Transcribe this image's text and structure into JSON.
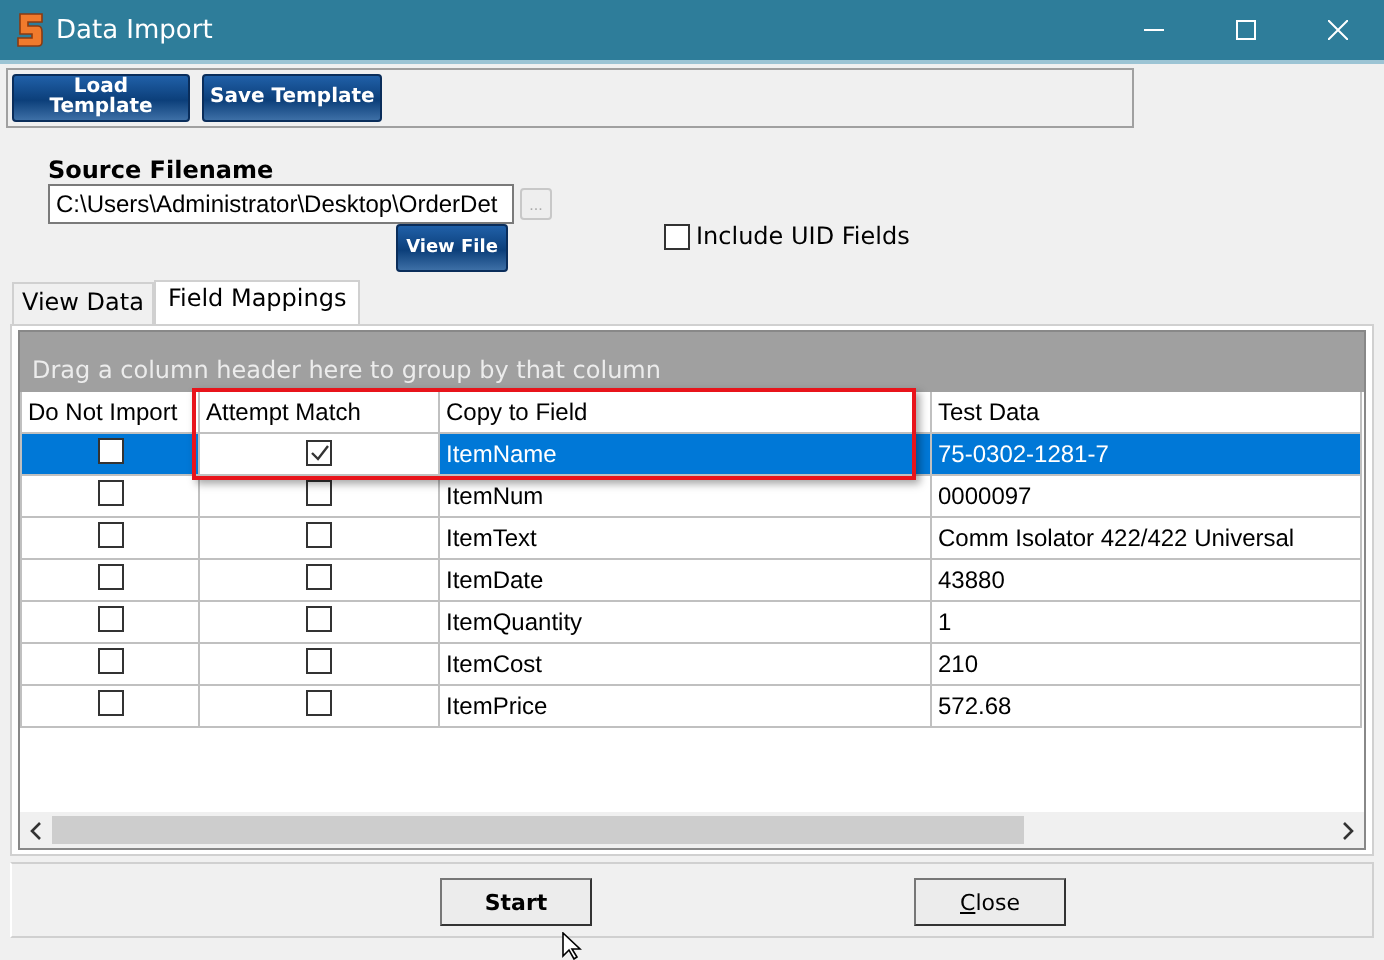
{
  "window": {
    "title": "Data Import"
  },
  "toolbar": {
    "buttons": [
      "Load Template",
      "Save Template"
    ]
  },
  "source": {
    "label": "Source Filename",
    "value": "C:\\Users\\Administrator\\Desktop\\OrderDet",
    "browse": "...",
    "view_button": "View File"
  },
  "include_uid": {
    "label": "Include UID Fields",
    "checked": false
  },
  "tabs": [
    {
      "label": "View Data",
      "selected": false
    },
    {
      "label": "Field Mappings",
      "selected": true
    }
  ],
  "grid": {
    "group_hint": "Drag a column header here to group by that column",
    "columns": [
      "Do Not Import",
      "Attempt Match",
      "Copy to Field",
      "Test Data"
    ],
    "rows": [
      {
        "do_not_import": false,
        "attempt_match": true,
        "field": "ItemName",
        "test_data": "75-0302-1281-7",
        "selected": true
      },
      {
        "do_not_import": false,
        "attempt_match": false,
        "field": "ItemNum",
        "test_data": "0000097",
        "selected": false
      },
      {
        "do_not_import": false,
        "attempt_match": false,
        "field": "ItemText",
        "test_data": "Comm Isolator 422/422 Universal",
        "selected": false
      },
      {
        "do_not_import": false,
        "attempt_match": false,
        "field": "ItemDate",
        "test_data": "43880",
        "selected": false
      },
      {
        "do_not_import": false,
        "attempt_match": false,
        "field": "ItemQuantity",
        "test_data": "1",
        "selected": false
      },
      {
        "do_not_import": false,
        "attempt_match": false,
        "field": "ItemCost",
        "test_data": "210",
        "selected": false
      },
      {
        "do_not_import": false,
        "attempt_match": false,
        "field": "ItemPrice",
        "test_data": "572.68",
        "selected": false
      }
    ]
  },
  "buttons": [
    {
      "label": "Start",
      "default": true
    },
    {
      "label": "Close",
      "default": false
    }
  ]
}
